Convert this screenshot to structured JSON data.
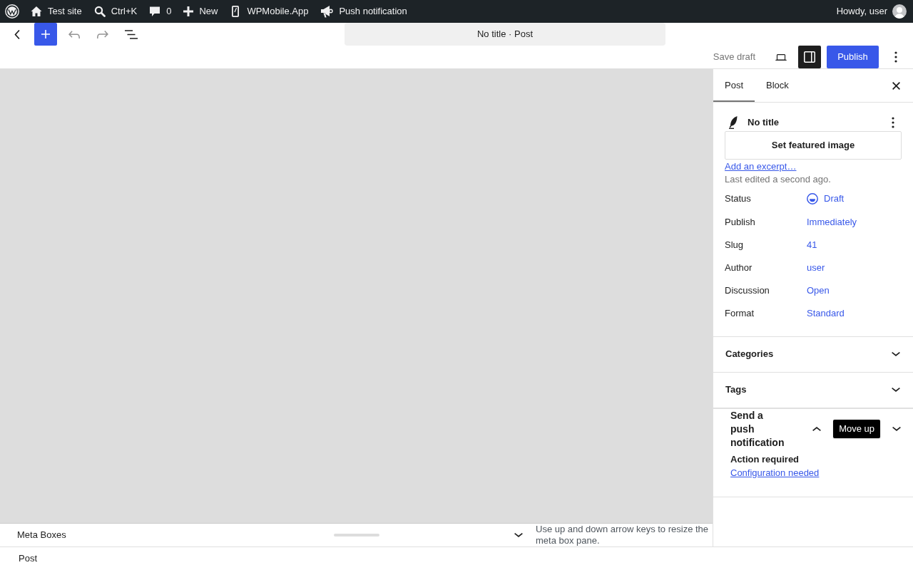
{
  "admin_bar": {
    "items": [
      {
        "label": "Test site"
      },
      {
        "label": "Ctrl+K"
      },
      {
        "label": "0"
      },
      {
        "label": "New"
      },
      {
        "label": "WPMobile.App"
      },
      {
        "label": "Push notification"
      }
    ],
    "greeting": "Howdy, user"
  },
  "editor_header": {
    "undo": {
      "disabled": true
    },
    "redo": {
      "disabled": true
    },
    "document_title": "No title · Post",
    "save_draft": "Save draft",
    "sidebar_toggle": {
      "on": true
    },
    "publish": "Publish"
  },
  "meta_boxes": {
    "title": "Meta Boxes",
    "help": "Use up and down arrow keys to resize the meta box pane."
  },
  "sidebar": {
    "tabs": [
      {
        "label": "Post",
        "selected": true
      },
      {
        "label": "Block",
        "selected": false
      }
    ],
    "post": {
      "title": "No title",
      "featured_image_button": "Set featured image",
      "excerpt_link": "Add an excerpt…",
      "last_edited": "Last edited a second ago.",
      "fields": [
        {
          "kind": "status",
          "label": "Status",
          "value": "Draft"
        },
        {
          "kind": "link",
          "label": "Publish",
          "value": "Immediately"
        },
        {
          "kind": "link",
          "label": "Slug",
          "value": "41"
        },
        {
          "kind": "link",
          "label": "Author",
          "value": "user"
        },
        {
          "kind": "link",
          "label": "Discussion",
          "value": "Open"
        },
        {
          "kind": "link",
          "label": "Format",
          "value": "Standard"
        }
      ]
    },
    "panels": [
      {
        "title": "Categories",
        "expanded": false
      },
      {
        "title": "Tags",
        "expanded": false
      }
    ],
    "push_panel": {
      "title": "Send a push notification",
      "tooltip": "Move up",
      "heading": "Action required",
      "link": "Configuration needed"
    }
  },
  "footer": {
    "breadcrumb": "Post"
  }
}
